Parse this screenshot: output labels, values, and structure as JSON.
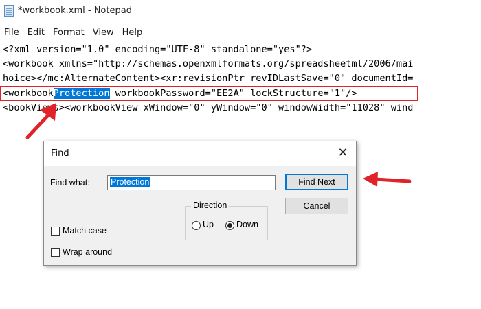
{
  "window": {
    "title": "*workbook.xml - Notepad"
  },
  "menu": [
    "File",
    "Edit",
    "Format",
    "View",
    "Help"
  ],
  "editor": {
    "lines": [
      "<?xml version=\"1.0\" encoding=\"UTF-8\" standalone=\"yes\"?>",
      "<workbook xmlns=\"http://schemas.openxmlformats.org/spreadsheetml/2006/mai",
      "hoice></mc:AlternateContent><xr:revisionPtr revIDLastSave=\"0\" documentId=",
      "",
      "<bookViews><workbookView xWindow=\"0\" yWindow=\"0\" windowWidth=\"11028\" wind"
    ],
    "highlight_line": {
      "before": "<workbook",
      "selected": "Protection",
      "after": " workbookPassword=\"EE2A\" lockStructure=\"1\"/>"
    },
    "annotation_color": "#e0232a",
    "selection_color": "#0078d7"
  },
  "find_dialog": {
    "title": "Find",
    "close_glyph": "✕",
    "find_what_label": "Find what:",
    "find_value": "Protection",
    "find_next_label": "Find Next",
    "cancel_label": "Cancel",
    "direction_label": "Direction",
    "up_label": "Up",
    "down_label": "Down",
    "direction_selected": "down",
    "match_case_label": "Match case",
    "wrap_around_label": "Wrap around",
    "match_case_checked": false,
    "wrap_around_checked": false
  }
}
